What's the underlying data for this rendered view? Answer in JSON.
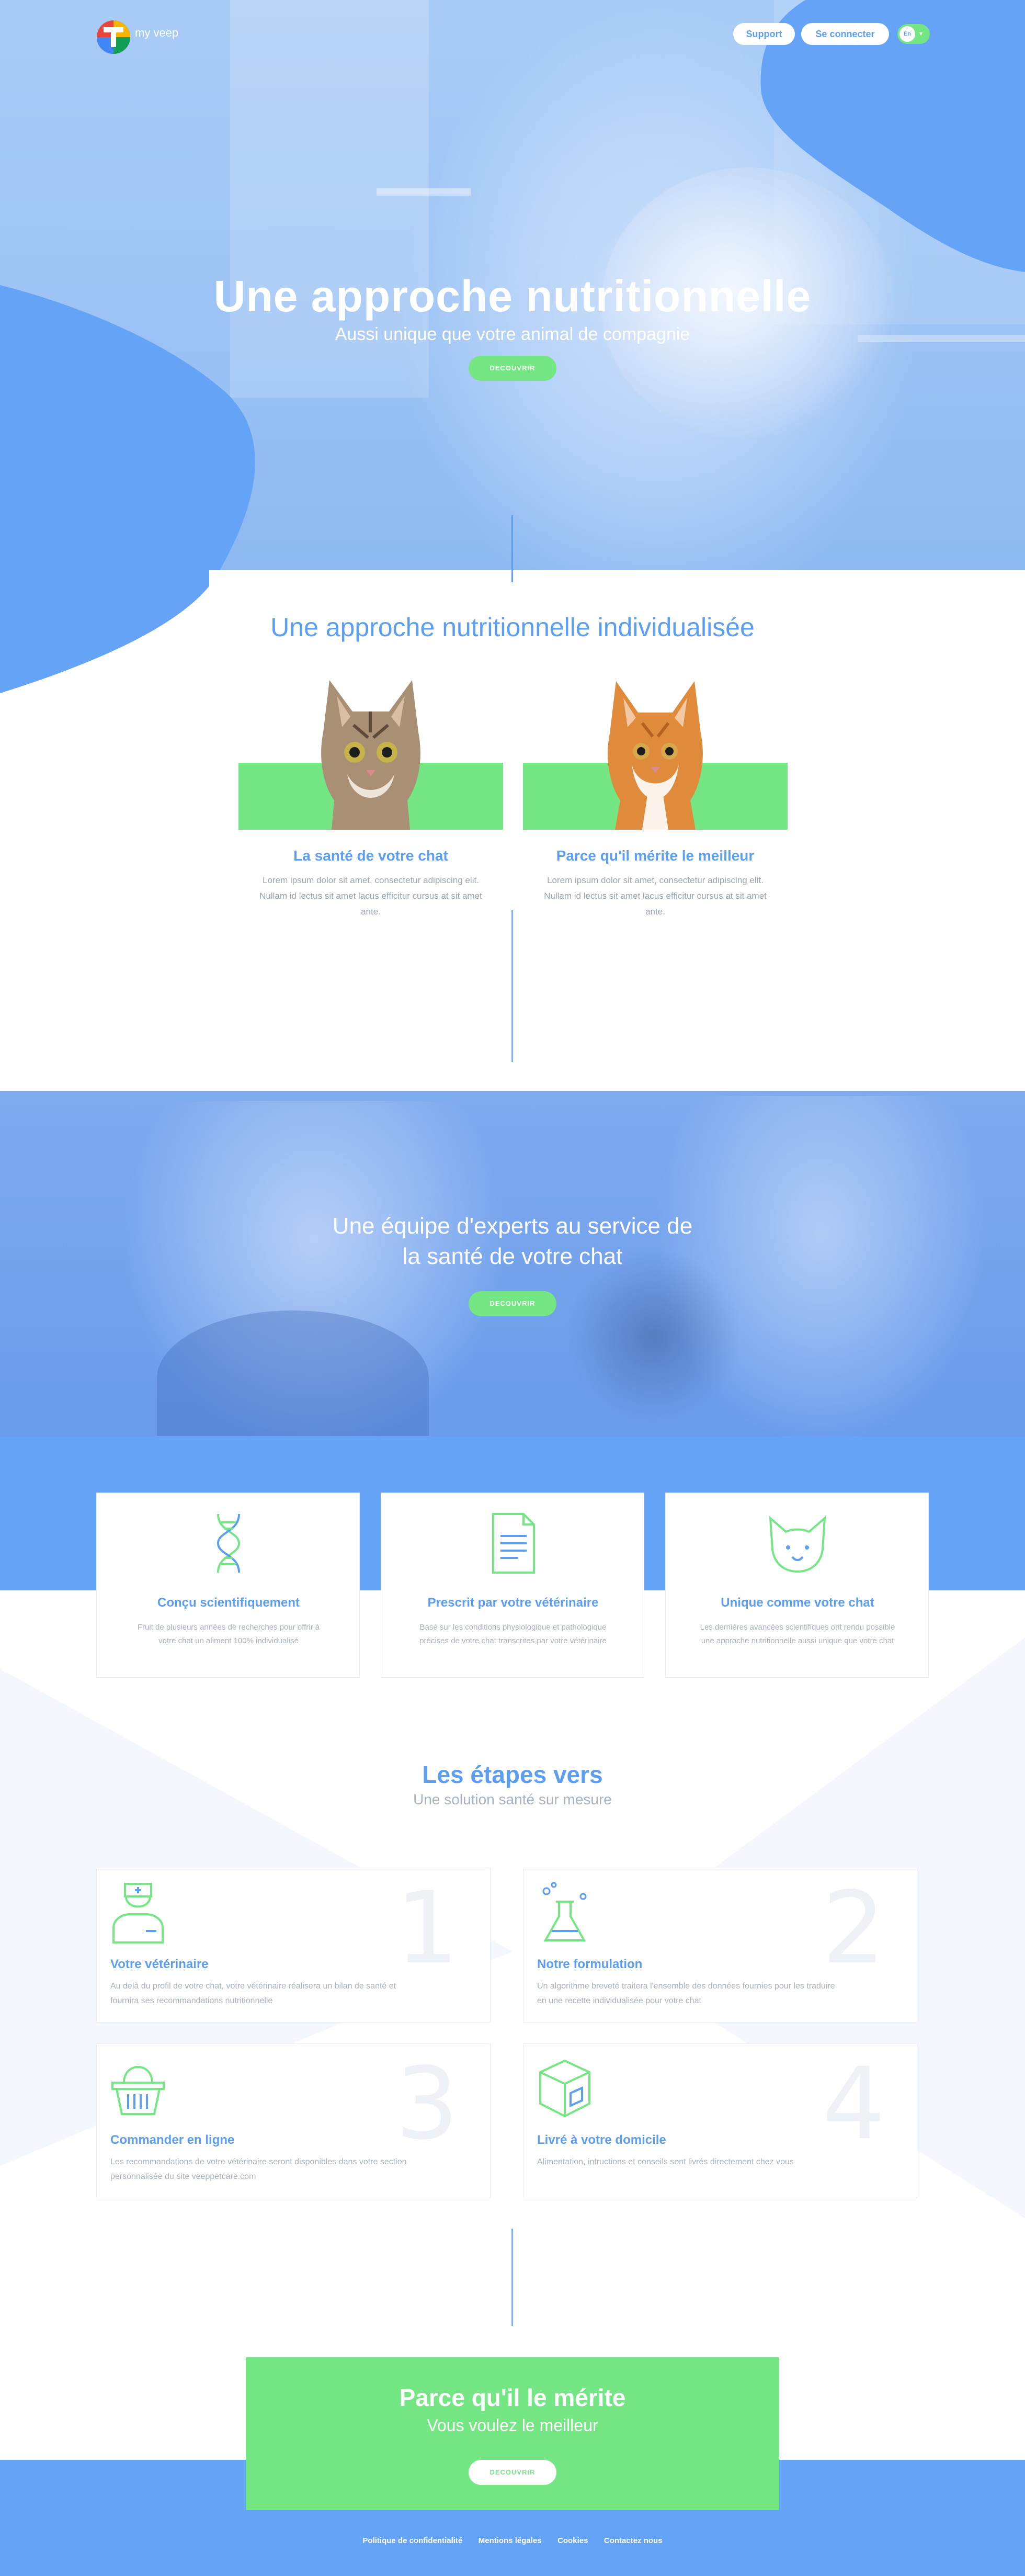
{
  "header": {
    "logo_text": "my veep",
    "support_label": "Support",
    "login_label": "Se connecter",
    "lang_label": "En"
  },
  "hero": {
    "title": "Une approche nutritionnelle",
    "subtitle": "Aussi unique que votre animal de compagnie",
    "cta_label": "DECOUVRIR"
  },
  "approach": {
    "title": "Une approche nutritionnelle individualisée",
    "cards": [
      {
        "title": "La santé de votre chat",
        "text": "Lorem ipsum dolor sit amet, consectetur adipiscing elit. Nullam id lectus sit amet lacus efficitur cursus at sit amet ante."
      },
      {
        "title": "Parce qu'il mérite le meilleur",
        "text": "Lorem ipsum dolor sit amet, consectetur adipiscing elit. Nullam id lectus sit amet lacus efficitur cursus at sit amet ante."
      }
    ]
  },
  "experts": {
    "title_line1": "Une équipe d'experts au service de",
    "title_line2": "la santé de votre chat",
    "cta_label": "DECOUVRIR"
  },
  "features": [
    {
      "icon": "dna-icon",
      "title": "Conçu scientifiquement",
      "text": "Fruit de plusieurs années de recherches pour offrir à votre chat un aliment 100% individualisé"
    },
    {
      "icon": "document-icon",
      "title": "Prescrit par votre vétérinaire",
      "text": "Basé sur les conditions physiologique et pathologique précises de votre chat transcrites par votre vétérinaire"
    },
    {
      "icon": "cat-face-icon",
      "title": "Unique comme votre chat",
      "text": "Les dernières avancées scientifiques ont rendu possible une approche nutritionnelle aussi unique que votre chat"
    }
  ],
  "steps": {
    "title": "Les étapes vers",
    "subtitle": "Une solution santé sur mesure",
    "items": [
      {
        "number": "1",
        "icon": "veterinarian-icon",
        "title": "Votre vétérinaire",
        "text": "Au delà du profil de votre chat, votre vétérinaire réalisera un bilan de santé et fournira ses recommandations nutritionnelle"
      },
      {
        "number": "2",
        "icon": "flask-icon",
        "title": "Notre formulation",
        "text": "Un algorithme breveté traitera l'ensemble des données fournies pour les traduire en une recette individualisée pour votre chat"
      },
      {
        "number": "3",
        "icon": "basket-icon",
        "title": "Commander en ligne",
        "text": "Les recommandations de votre vétérinaire seront disponibles dans votre section personnalisée du site veeppetcare.com"
      },
      {
        "number": "4",
        "icon": "package-icon",
        "title": "Livré à votre domicile",
        "text": "Alimentation, intructions et conseils sont livrés directement chez vous"
      }
    ]
  },
  "cta": {
    "title": "Parce qu'il le mérite",
    "subtitle": "Vous voulez le meilleur",
    "button_label": "DECOUVRIR"
  },
  "footer": {
    "links": [
      "Politique de confidentialité",
      "Mentions légales",
      "Cookies",
      "Contactez nous"
    ]
  },
  "colors": {
    "primary_blue": "#5c9ef1",
    "band_blue": "#64a3f6",
    "accent_green": "#74e684"
  }
}
